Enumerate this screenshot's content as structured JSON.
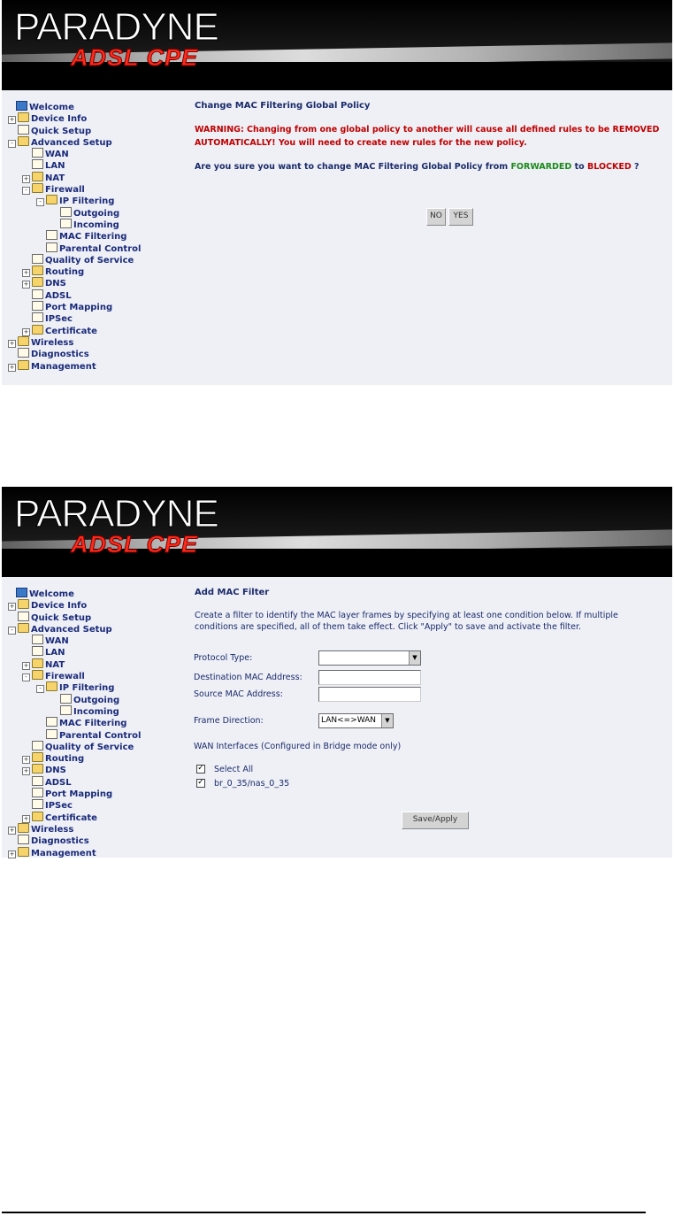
{
  "brand": {
    "name": "PARADYNE",
    "reg": "®",
    "product": "ADSL CPE"
  },
  "tree": [
    {
      "label": "Welcome",
      "level": 0,
      "type": "monitor",
      "pm": ""
    },
    {
      "label": "Device Info",
      "level": 0,
      "type": "folder",
      "pm": "+"
    },
    {
      "label": "Quick Setup",
      "level": 0,
      "type": "page",
      "pm": ""
    },
    {
      "label": "Advanced Setup",
      "level": 0,
      "type": "folder",
      "pm": "−"
    },
    {
      "label": "WAN",
      "level": 1,
      "type": "page",
      "pm": ""
    },
    {
      "label": "LAN",
      "level": 1,
      "type": "page",
      "pm": ""
    },
    {
      "label": "NAT",
      "level": 1,
      "type": "folder",
      "pm": "+"
    },
    {
      "label": "Firewall",
      "level": 1,
      "type": "folder",
      "pm": "−"
    },
    {
      "label": "IP Filtering",
      "level": 2,
      "type": "folder",
      "pm": "−"
    },
    {
      "label": "Outgoing",
      "level": 3,
      "type": "page",
      "pm": ""
    },
    {
      "label": "Incoming",
      "level": 3,
      "type": "page",
      "pm": ""
    },
    {
      "label": "MAC Filtering",
      "level": 2,
      "type": "page",
      "pm": ""
    },
    {
      "label": "Parental Control",
      "level": 2,
      "type": "page",
      "pm": ""
    },
    {
      "label": "Quality of Service",
      "level": 1,
      "type": "page",
      "pm": ""
    },
    {
      "label": "Routing",
      "level": 1,
      "type": "folder",
      "pm": "+"
    },
    {
      "label": "DNS",
      "level": 1,
      "type": "folder",
      "pm": "+"
    },
    {
      "label": "ADSL",
      "level": 1,
      "type": "page",
      "pm": ""
    },
    {
      "label": "Port Mapping",
      "level": 1,
      "type": "page",
      "pm": ""
    },
    {
      "label": "IPSec",
      "level": 1,
      "type": "page",
      "pm": ""
    },
    {
      "label": "Certificate",
      "level": 1,
      "type": "folder",
      "pm": "+"
    },
    {
      "label": "Wireless",
      "level": 0,
      "type": "folder",
      "pm": "+"
    },
    {
      "label": "Diagnostics",
      "level": 0,
      "type": "page",
      "pm": ""
    },
    {
      "label": "Management",
      "level": 0,
      "type": "folder",
      "pm": "+"
    }
  ],
  "screen1": {
    "title": "Change MAC Filtering Global Policy",
    "warning": "WARNING: Changing from one global policy to another will cause all defined rules to be REMOVED AUTOMATICALLY! You will need to create new rules for the new policy.",
    "question_prefix": "Are you sure you want to change MAC Filtering Global Policy from ",
    "from_policy": "FORWARDED",
    "to_word": " to ",
    "to_policy": "BLOCKED",
    "question_suffix": " ?",
    "no_label": "NO",
    "yes_label": "YES"
  },
  "screen2": {
    "title": "Add MAC Filter",
    "description": "Create a filter to identify the MAC layer frames by specifying at least one condition below. If multiple conditions are specified, all of them take effect. Click \"Apply\" to save and activate the filter.",
    "protocol_label": "Protocol Type:",
    "protocol_value": "",
    "dest_label": "Destination MAC Address:",
    "dest_value": "",
    "src_label": "Source MAC Address:",
    "src_value": "",
    "direction_label": "Frame Direction:",
    "direction_value": "LAN<=>WAN",
    "wan_label": "WAN Interfaces (Configured in Bridge mode only)",
    "select_all_label": "Select All",
    "iface_label": "br_0_35/nas_0_35",
    "save_label": "Save/Apply"
  },
  "colors": {
    "accent_red": "#c00000",
    "accent_green": "#1a8a1a",
    "panel_bg": "#eef0f6",
    "text_blue": "#1a2a6a"
  }
}
